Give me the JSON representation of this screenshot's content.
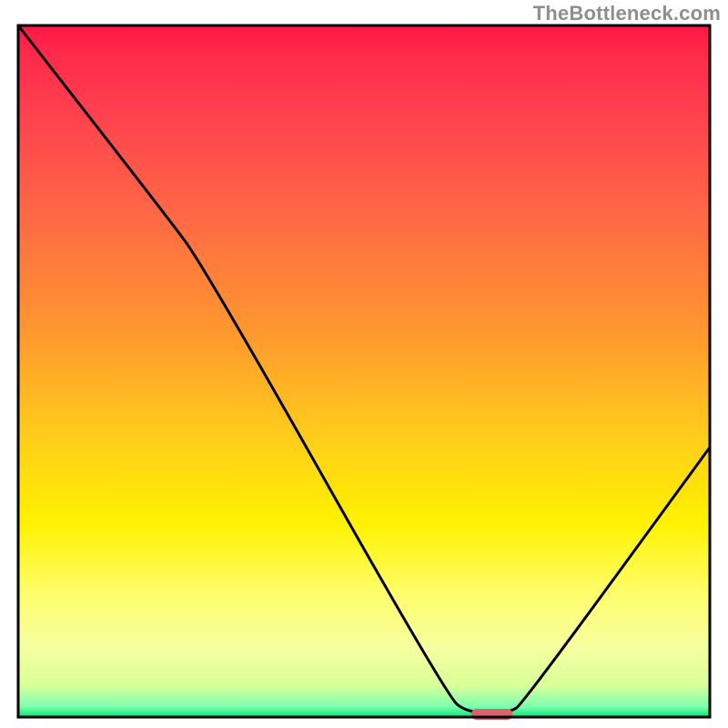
{
  "watermark": "TheBottleneck.com",
  "chart_data": {
    "type": "line",
    "title": "",
    "xlabel": "",
    "ylabel": "",
    "x_range": [
      0,
      100
    ],
    "y_range": [
      0,
      100
    ],
    "curve": [
      {
        "x": 0,
        "y": 100
      },
      {
        "x": 21,
        "y": 73
      },
      {
        "x": 27,
        "y": 65
      },
      {
        "x": 62,
        "y": 3
      },
      {
        "x": 65,
        "y": 0.6
      },
      {
        "x": 71,
        "y": 0.6
      },
      {
        "x": 73,
        "y": 2
      },
      {
        "x": 100,
        "y": 39
      }
    ],
    "marker": {
      "x_start": 65.5,
      "x_end": 71.5,
      "y": 0.4,
      "color": "#d9636c"
    },
    "gradient_stops": [
      {
        "offset": 0.0,
        "color": "#ff1744"
      },
      {
        "offset": 0.04,
        "color": "#ff2a4a"
      },
      {
        "offset": 0.12,
        "color": "#ff3f4f"
      },
      {
        "offset": 0.28,
        "color": "#ff6a44"
      },
      {
        "offset": 0.45,
        "color": "#ff9a2e"
      },
      {
        "offset": 0.6,
        "color": "#ffcf1a"
      },
      {
        "offset": 0.72,
        "color": "#fff200"
      },
      {
        "offset": 0.82,
        "color": "#fffd6b"
      },
      {
        "offset": 0.9,
        "color": "#f6ffa0"
      },
      {
        "offset": 0.955,
        "color": "#d7ff9a"
      },
      {
        "offset": 0.985,
        "color": "#7dffae"
      },
      {
        "offset": 1.0,
        "color": "#00e676"
      }
    ],
    "frame": {
      "stroke": "#000000",
      "stroke_width": 3
    },
    "curve_style": {
      "stroke": "#000000",
      "stroke_width": 3
    }
  }
}
